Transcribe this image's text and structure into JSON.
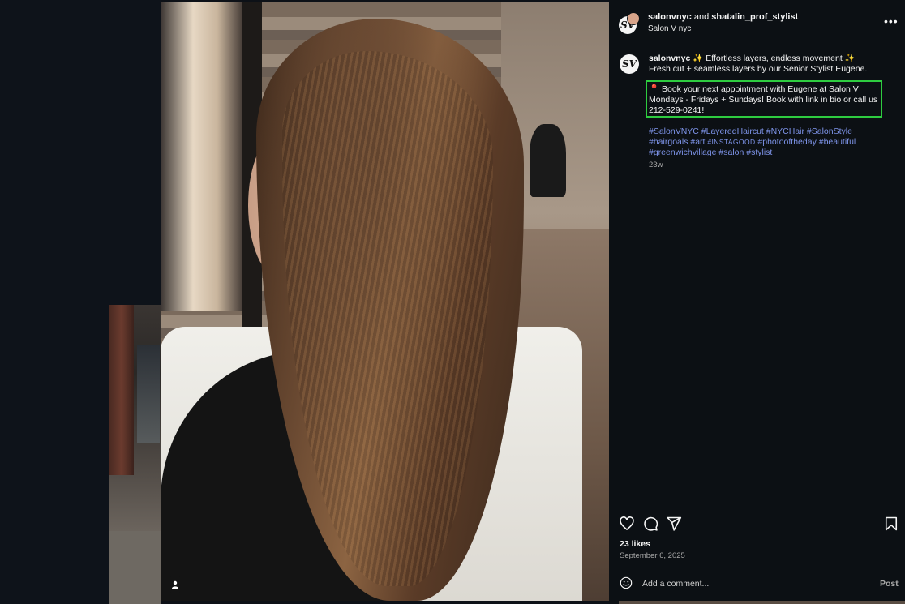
{
  "post": {
    "header": {
      "author": "salonvnyc",
      "joiner": "and",
      "coauthor": "shatalin_prof_stylist",
      "location": "Salon V nyc",
      "avatar_letter": "SV",
      "more_icon": "more-horizontal-icon"
    },
    "caption": {
      "username": "salonvnyc",
      "line1": "✨ Effortless layers, endless movement ✨",
      "line2": "Fresh cut + seamless layers by our Senior Stylist Eugene.",
      "booking": "📍 Book your next appointment with Eugene at Salon V Mondays - Fridays + Sundays! Book with link in bio or call us 212-529-0241!",
      "hashtags_a": "#SalonVNYC #LayeredHaircut #NYCHair #SalonStyle #hairgoals #art ",
      "hashtag_smallcaps": "#instagood",
      "hashtags_b": " #photooftheday #beautiful #greenwichvillage #salon #stylist",
      "time_ago": "23w"
    },
    "actions": {
      "like_icon": "heart-icon",
      "comment_icon": "comment-icon",
      "share_icon": "share-icon",
      "save_icon": "bookmark-icon"
    },
    "likes": "23 likes",
    "date": "September 6, 2025",
    "comment": {
      "placeholder": "Add a comment...",
      "post_label": "Post",
      "emoji_icon": "emoji-icon"
    },
    "media": {
      "user_tag_icon": "user-tag-icon"
    },
    "colors": {
      "panel_bg": "#0c1014",
      "hashtag": "#7d93e8",
      "highlight": "#2ecc40",
      "muted": "#a8a8a8"
    }
  }
}
